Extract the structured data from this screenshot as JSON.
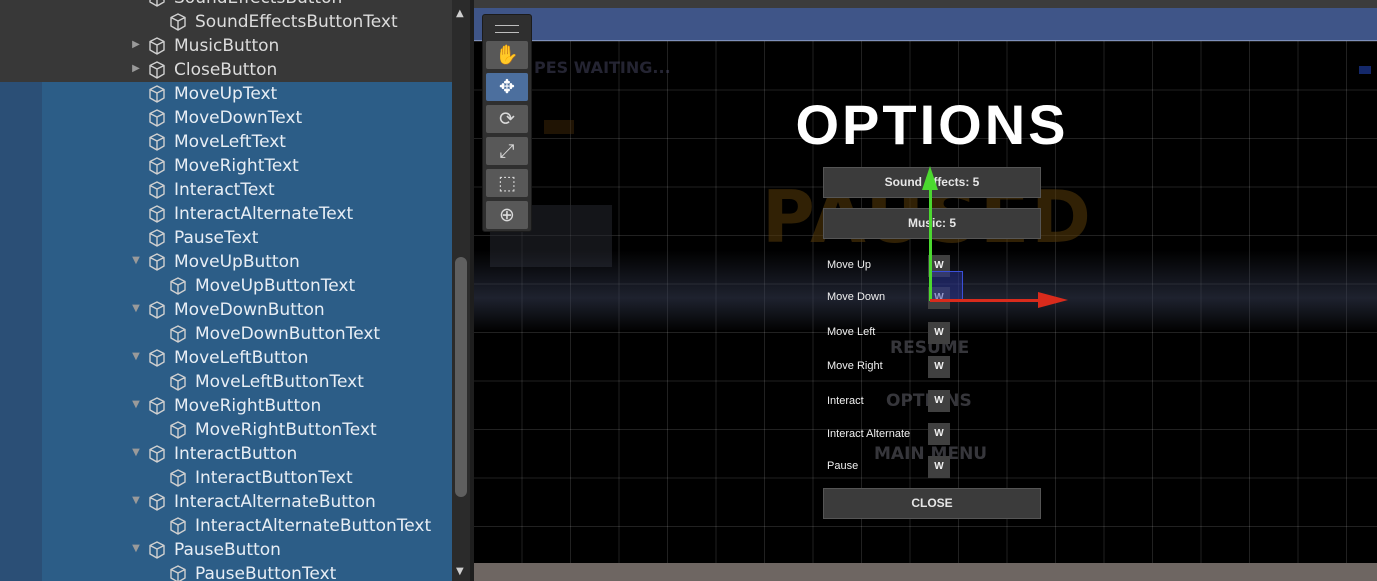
{
  "hierarchy": {
    "items": [
      {
        "label": "SoundEffectsButton",
        "indent": 1,
        "arrow": "",
        "selected": false
      },
      {
        "label": "SoundEffectsButtonText",
        "indent": 2,
        "arrow": "",
        "selected": false
      },
      {
        "label": "MusicButton",
        "indent": 1,
        "arrow": "collapsed",
        "selected": false
      },
      {
        "label": "CloseButton",
        "indent": 1,
        "arrow": "collapsed",
        "selected": false
      },
      {
        "label": "MoveUpText",
        "indent": 1,
        "arrow": "",
        "selected": true
      },
      {
        "label": "MoveDownText",
        "indent": 1,
        "arrow": "",
        "selected": true
      },
      {
        "label": "MoveLeftText",
        "indent": 1,
        "arrow": "",
        "selected": true
      },
      {
        "label": "MoveRightText",
        "indent": 1,
        "arrow": "",
        "selected": true
      },
      {
        "label": "InteractText",
        "indent": 1,
        "arrow": "",
        "selected": true
      },
      {
        "label": "InteractAlternateText",
        "indent": 1,
        "arrow": "",
        "selected": true
      },
      {
        "label": "PauseText",
        "indent": 1,
        "arrow": "",
        "selected": true
      },
      {
        "label": "MoveUpButton",
        "indent": 1,
        "arrow": "expanded",
        "selected": true
      },
      {
        "label": "MoveUpButtonText",
        "indent": 2,
        "arrow": "",
        "selected": true
      },
      {
        "label": "MoveDownButton",
        "indent": 1,
        "arrow": "expanded",
        "selected": true
      },
      {
        "label": "MoveDownButtonText",
        "indent": 2,
        "arrow": "",
        "selected": true
      },
      {
        "label": "MoveLeftButton",
        "indent": 1,
        "arrow": "expanded",
        "selected": true
      },
      {
        "label": "MoveLeftButtonText",
        "indent": 2,
        "arrow": "",
        "selected": true
      },
      {
        "label": "MoveRightButton",
        "indent": 1,
        "arrow": "expanded",
        "selected": true
      },
      {
        "label": "MoveRightButtonText",
        "indent": 2,
        "arrow": "",
        "selected": true
      },
      {
        "label": "InteractButton",
        "indent": 1,
        "arrow": "expanded",
        "selected": true
      },
      {
        "label": "InteractButtonText",
        "indent": 2,
        "arrow": "",
        "selected": true
      },
      {
        "label": "InteractAlternateButton",
        "indent": 1,
        "arrow": "expanded",
        "selected": true
      },
      {
        "label": "InteractAlternateButtonText",
        "indent": 2,
        "arrow": "",
        "selected": true
      },
      {
        "label": "PauseButton",
        "indent": 1,
        "arrow": "expanded",
        "selected": true
      },
      {
        "label": "PauseButtonText",
        "indent": 2,
        "arrow": "",
        "selected": true
      }
    ]
  },
  "scene": {
    "background_text": {
      "waiting": "PES WAITING...",
      "paused": "PAUSED",
      "resume": "RESUME",
      "options": "OPTIONS",
      "main_menu": "MAIN MENU"
    },
    "tools": [
      {
        "name": "hand-tool",
        "icon": "hand-icon",
        "glyph": "✋",
        "active": false
      },
      {
        "name": "move-tool",
        "icon": "move-icon",
        "glyph": "✥",
        "active": true
      },
      {
        "name": "rotate-tool",
        "icon": "rotate-icon",
        "glyph": "⟳",
        "active": false
      },
      {
        "name": "scale-tool",
        "icon": "scale-icon",
        "glyph": "⤢",
        "active": false
      },
      {
        "name": "rect-tool",
        "icon": "rect-transform-icon",
        "glyph": "⬚",
        "active": false
      },
      {
        "name": "transform-tool",
        "icon": "transform-icon",
        "glyph": "⊕",
        "active": false
      }
    ],
    "options_menu": {
      "title": "OPTIONS",
      "sound_effects": "Sound Effects: 5",
      "music": "Music: 5",
      "close": "CLOSE",
      "bindings": [
        {
          "action": "Move Up",
          "key": "W"
        },
        {
          "action": "Move Down",
          "key": "W"
        },
        {
          "action": "Move Left",
          "key": "W"
        },
        {
          "action": "Move Right",
          "key": "W"
        },
        {
          "action": "Interact",
          "key": "W"
        },
        {
          "action": "Interact Alternate",
          "key": "W"
        },
        {
          "action": "Pause",
          "key": "W"
        }
      ]
    },
    "colors": {
      "selection": "#2c5d87",
      "gizmo_y": "#4bd82f",
      "gizmo_x": "#d92b1c",
      "active_tool": "#4c6f9e"
    }
  }
}
